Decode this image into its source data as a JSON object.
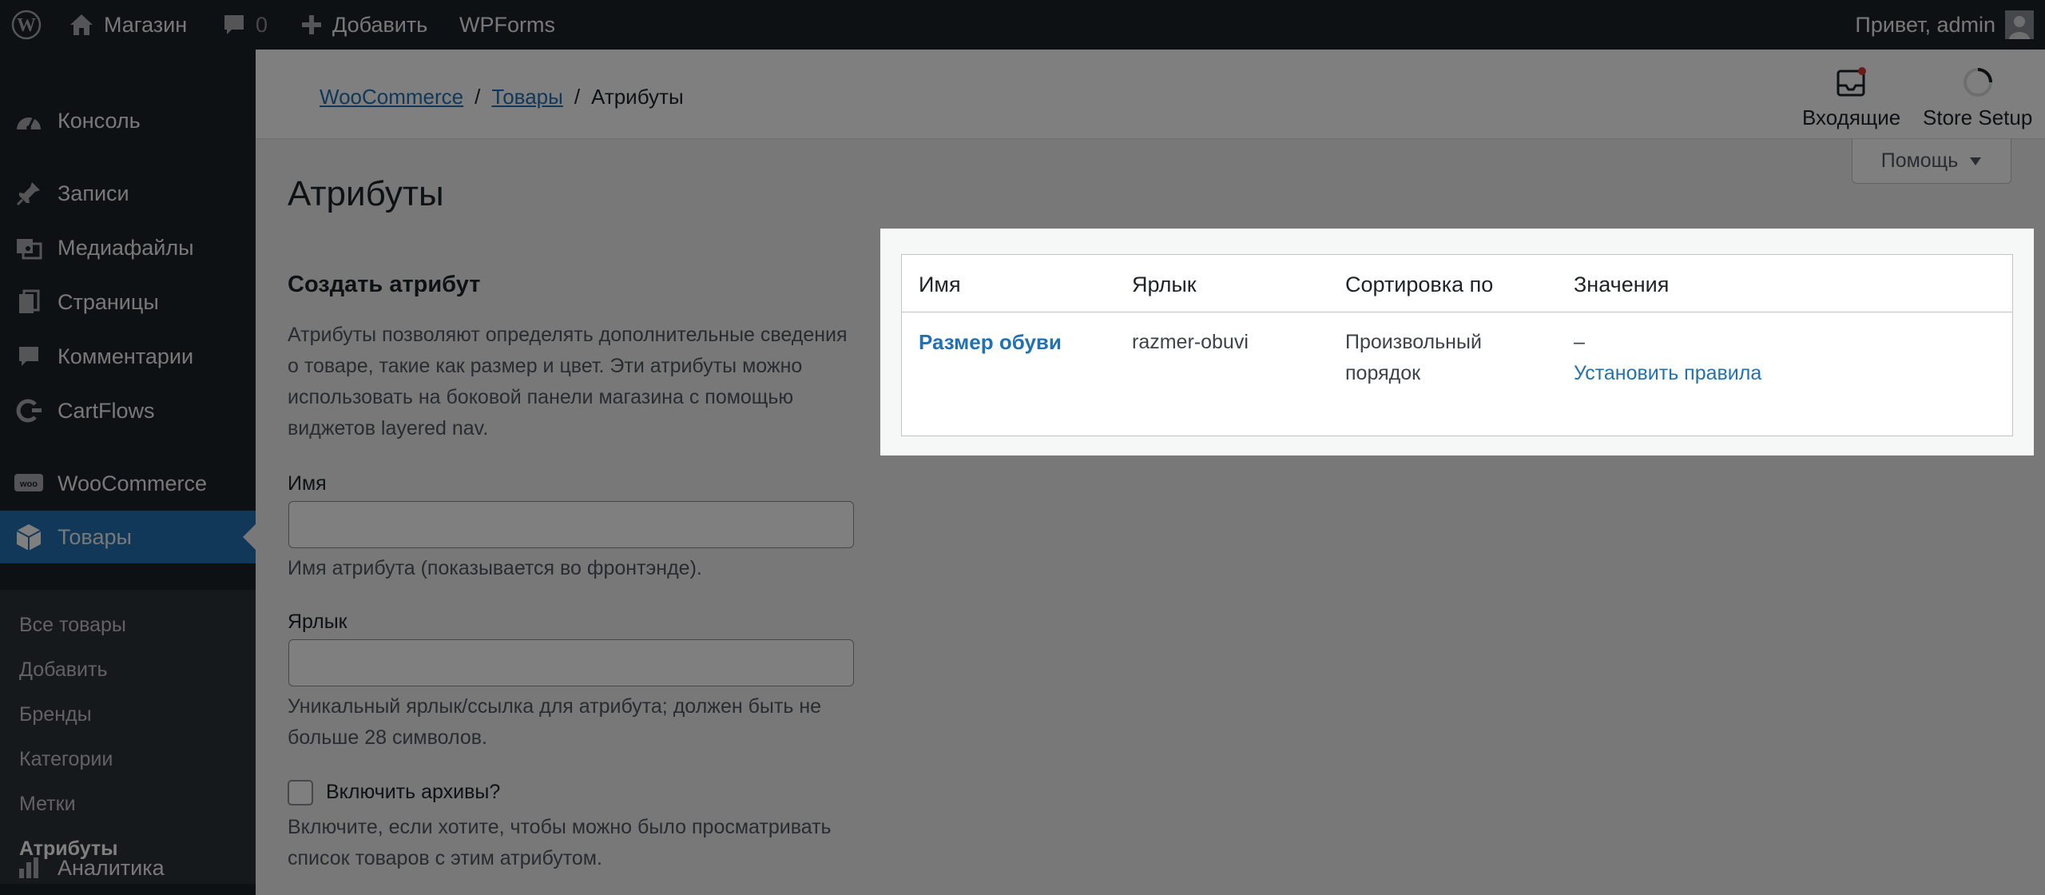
{
  "adminbar": {
    "site_name": "Магазин",
    "comments_count": "0",
    "add_label": "Добавить",
    "wpforms_label": "WPForms",
    "greeting": "Привет, admin"
  },
  "sidebar": {
    "items": [
      {
        "label": "Консоль",
        "icon": "dashboard-icon"
      },
      {
        "label": "Записи",
        "icon": "pin-icon"
      },
      {
        "label": "Медиафайлы",
        "icon": "media-icon"
      },
      {
        "label": "Страницы",
        "icon": "pages-icon"
      },
      {
        "label": "Комментарии",
        "icon": "comment-icon"
      },
      {
        "label": "CartFlows",
        "icon": "cartflows-icon"
      },
      {
        "label": "WooCommerce",
        "icon": "woo-icon"
      },
      {
        "label": "Товары",
        "icon": "box-icon"
      },
      {
        "label": "Аналитика",
        "icon": "chart-icon"
      }
    ],
    "submenu": [
      "Все товары",
      "Добавить",
      "Бренды",
      "Категории",
      "Метки",
      "Атрибуты"
    ]
  },
  "header": {
    "breadcrumb": [
      "WooCommerce",
      "Товары",
      "Атрибуты"
    ],
    "separator": "/",
    "inbox_label": "Входящие",
    "setup_label": "Store Setup",
    "help_label": "Помощь"
  },
  "main": {
    "title": "Атрибуты",
    "form_title": "Создать атрибут",
    "form_desc": "Атрибуты позволяют определять дополнительные сведения о товаре, такие как размер и цвет. Эти атрибуты можно использовать на боковой панели магазина с помощью виджетов layered nav.",
    "name_label": "Имя",
    "name_help": "Имя атрибута (показывается во фронтэнде).",
    "slug_label": "Ярлык",
    "slug_help": "Уникальный ярлык/ссылка для атрибута; должен быть не больше 28 символов.",
    "archive_label": "Включить архивы?",
    "archive_help": "Включите, если хотите, чтобы можно было просматривать список товаров с этим атрибутом."
  },
  "table": {
    "headers": [
      "Имя",
      "Ярлык",
      "Сортировка по",
      "Значения"
    ],
    "rows": [
      {
        "name": "Размер обуви",
        "slug": "razmer-obuvi",
        "order_line1": "Произвольный",
        "order_line2": "порядок",
        "values": "–",
        "configure": "Установить правила"
      }
    ]
  },
  "colors": {
    "accent": "#2271b1",
    "adminbar": "#1d2327",
    "overlay": "rgba(0,0,0,0.5)"
  }
}
